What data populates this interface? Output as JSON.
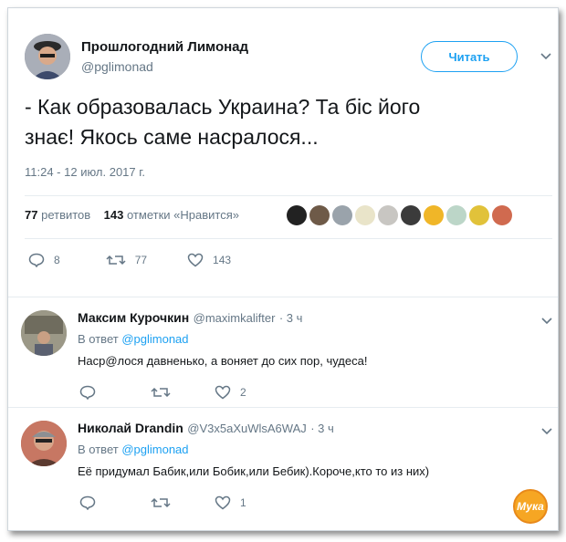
{
  "tweet": {
    "author_name": "Прошлогодний Лимонад",
    "author_handle": "@pglimonad",
    "follow_label": "Читать",
    "text_line1": "- Как образовалась Украина? Та біс його",
    "text_line2": "знає! Якось саме насралося...",
    "timestamp": "11:24 - 12 июл. 2017 г.",
    "retweets_count": "77",
    "retweets_label": "ретвитов",
    "likes_count": "143",
    "likes_label": "отметки «Нравится»",
    "action_replies": "8",
    "action_retweets": "77",
    "action_likes": "143"
  },
  "replies": [
    {
      "name": "Максим Курочкин",
      "handle": "@maximkalifter",
      "time": "· 3 ч",
      "reply_to_prefix": "В ответ",
      "reply_to_handle": "@pglimonad",
      "text": "Наср@лося давненько, а воняет до сих пор, чудеса!",
      "retweets": "",
      "likes": "2"
    },
    {
      "name": "Николай Drandin",
      "handle": "@V3x5aXuWlsA6WAJ",
      "time": "· 3 ч",
      "reply_to_prefix": "В ответ",
      "reply_to_handle": "@pglimonad",
      "text": "Её придумал Бабик,или Бобик,или Бебик).Короче,кто то из них)",
      "retweets": "",
      "likes": "1"
    }
  ],
  "watermark": "Мука",
  "colors": {
    "accent": "#1da1f2",
    "muted": "#657786",
    "text": "#14171a",
    "divider": "#e6ecf0"
  }
}
